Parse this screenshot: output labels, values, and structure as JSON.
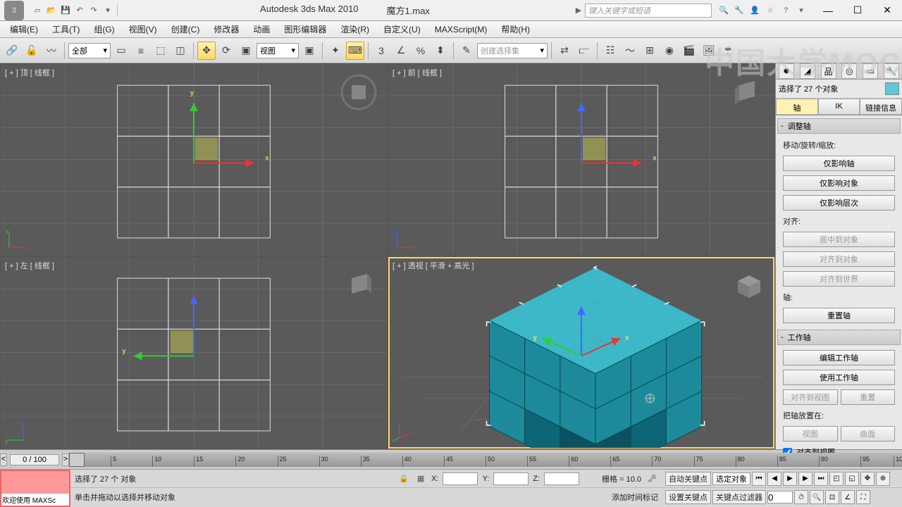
{
  "title": {
    "app": "Autodesk 3ds Max  2010",
    "file": "魔方1.max"
  },
  "search": {
    "placeholder": "键入关键字或短语"
  },
  "menu": [
    "编辑(E)",
    "工具(T)",
    "组(G)",
    "视图(V)",
    "创建(C)",
    "修改器",
    "动画",
    "图形编辑器",
    "渲染(R)",
    "自定义(U)",
    "MAXScript(M)",
    "帮助(H)"
  ],
  "toolbar": {
    "filter": "全部",
    "ref": "视图",
    "selset": "创建选择集"
  },
  "viewports": {
    "top": "[ + ] 顶 [ 线框 ]",
    "front": "[ + ] 前 [ 线框 ]",
    "left": "[ + ] 左 [ 线框 ]",
    "persp": "[ + ] 透视 [ 平滑 + 高光 ]"
  },
  "panel": {
    "selection": "选择了 27 个对象",
    "tab_axis": "轴",
    "tab_ik": "IK",
    "tab_link": "链接信息",
    "rollout1": "调整轴",
    "move_label": "移动/旋转/缩放:",
    "affect_pivot": "仅影响轴",
    "affect_obj": "仅影响对象",
    "affect_hier": "仅影响层次",
    "align_label": "对齐:",
    "center_obj": "居中到对象",
    "align_obj": "对齐到对象",
    "align_world": "对齐到世界",
    "axis_label": "轴:",
    "reset_axis": "重置轴",
    "rollout2": "工作轴",
    "edit_wa": "编辑工作轴",
    "use_wa": "使用工作轴",
    "align_view": "对齐到视图",
    "reset": "重置",
    "place_label": "把轴放置在:",
    "view_btn": "视图",
    "surf_btn": "曲面",
    "align_view_chk": "对齐到视图"
  },
  "timeline": {
    "display": "0 / 100"
  },
  "status": {
    "welcome": "欢迎使用 MAXSc",
    "sel_msg": "选择了 27 个 对象",
    "hint": "单击并拖动以选择并移动对象",
    "x": "X:",
    "y": "Y:",
    "z": "Z:",
    "grid": "栅格 = 10.0",
    "autokey": "自动关键点",
    "setkey": "设置关键点",
    "keyfilt": "关键点过滤器",
    "selobj": "选定对象",
    "addtime": "添加时间标记"
  },
  "watermark": "中国大学MOC"
}
